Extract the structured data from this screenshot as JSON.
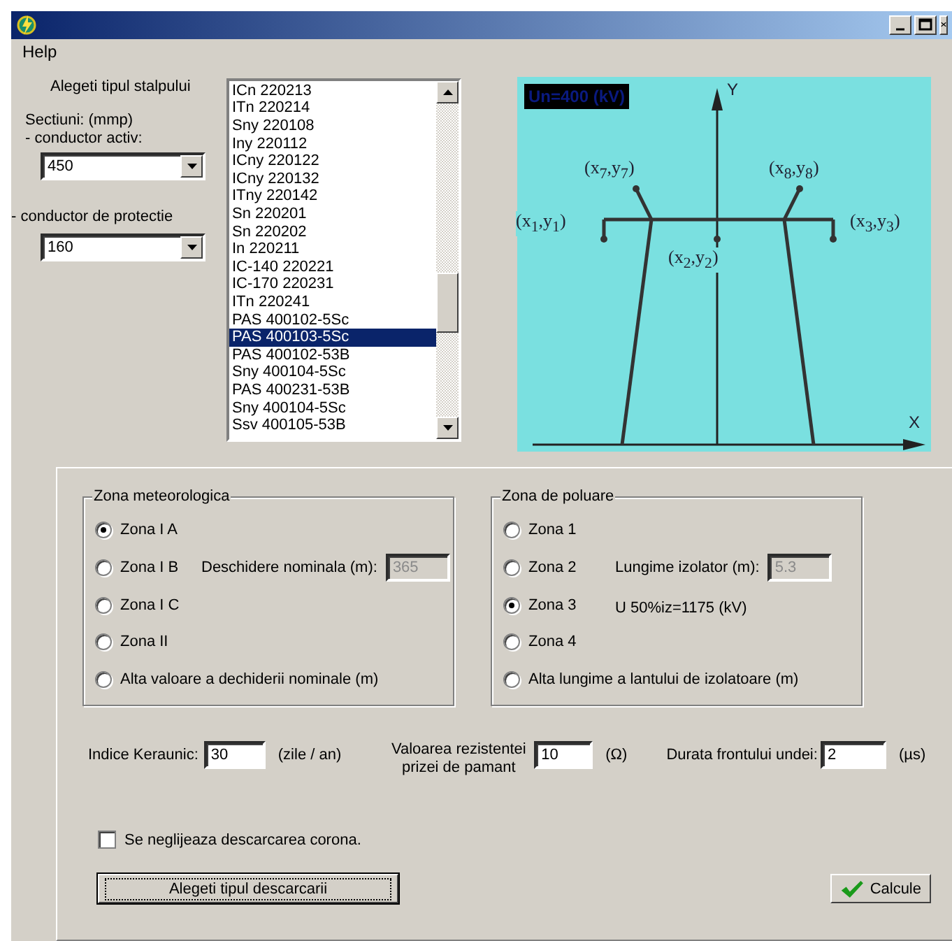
{
  "menu": [
    "Help"
  ],
  "pole_type": {
    "label": "Alegeti tipul stalpului",
    "items": [
      {
        "label": "ICn 220213",
        "selected": false
      },
      {
        "label": "ITn 220214",
        "selected": false
      },
      {
        "label": "Sny 220108",
        "selected": false
      },
      {
        "label": "Iny 220112",
        "selected": false
      },
      {
        "label": "ICny 220122",
        "selected": false
      },
      {
        "label": "ICny 220132",
        "selected": false
      },
      {
        "label": "ITny 220142",
        "selected": false
      },
      {
        "label": "Sn 220201",
        "selected": false
      },
      {
        "label": "Sn 220202",
        "selected": false
      },
      {
        "label": "In 220211",
        "selected": false
      },
      {
        "label": "IC-140 220221",
        "selected": false
      },
      {
        "label": "IC-170 220231",
        "selected": false
      },
      {
        "label": "ITn 220241",
        "selected": false
      },
      {
        "label": "PAS 400102-5Sc",
        "selected": false
      },
      {
        "label": "PAS 400103-5Sc",
        "selected": true
      },
      {
        "label": "PAS 400102-53B",
        "selected": false
      },
      {
        "label": "Sny 400104-5Sc",
        "selected": false
      },
      {
        "label": "PAS 400231-53B",
        "selected": false
      },
      {
        "label": "Sny 400104-5Sc",
        "selected": false
      },
      {
        "label": "Ssv 400105-53B",
        "selected": false
      }
    ]
  },
  "sections": {
    "label": "Sectiuni: (mmp)",
    "active_conductor": {
      "label": "- conductor activ:",
      "value": "450"
    },
    "protection_conductor": {
      "label": "- conductor de protectie",
      "value": "160"
    }
  },
  "diagram": {
    "voltage": "Un=400 (kV)",
    "y_axis": "Y",
    "x_axis": "X",
    "points": [
      "(x$_{7}$,y$_{7}$)",
      "(x$_{8}$,y$_{8}$)",
      "(x$_{1}$,y$_{1}$)",
      "(x$_{3}$,y$_{3}$)",
      "(x$_{2}$,y$_{2}$)"
    ]
  },
  "meteo_zone": {
    "title": "Zona meteorologica",
    "options": [
      {
        "label": "Zona I A",
        "selected": true
      },
      {
        "label": "Zona I B",
        "selected": false
      },
      {
        "label": "Zona I C",
        "selected": false
      },
      {
        "label": "Zona II",
        "selected": false
      },
      {
        "label": "Alta valoare a dechiderii nominale (m)",
        "selected": false
      }
    ],
    "field": {
      "label": "Deschidere nominala (m):",
      "value": "365",
      "disabled": true
    }
  },
  "pollution_zone": {
    "title": "Zona de poluare",
    "options": [
      {
        "label": "Zona 1",
        "selected": false
      },
      {
        "label": "Zona 2",
        "selected": false
      },
      {
        "label": "Zona 3",
        "selected": true
      },
      {
        "label": "Zona 4",
        "selected": false
      },
      {
        "label": "Alta lungime a lantului de izolatoare (m)",
        "selected": false
      }
    ],
    "field": {
      "label": "Lungime izolator (m):",
      "value": "5.3",
      "disabled": true
    },
    "note": "U 50%iz=1175 (kV)"
  },
  "params": [
    {
      "label": "Indice Keraunic:",
      "value": "30",
      "unit": "(zile / an)"
    },
    {
      "label": "Valoarea rezistentei prizei de pamant",
      "value": "10",
      "unit": "(Ω)"
    },
    {
      "label": "Durata frontului undei:",
      "value": "2",
      "unit": "(µs)"
    }
  ],
  "corona": {
    "label": "Se neglijeaza descarcarea corona.",
    "checked": false
  },
  "buttons": [
    {
      "kind": "plain",
      "label": "Alegeti tipul descarcarii",
      "focused": true
    },
    {
      "kind": "ok",
      "label": "Calcule",
      "focused": false
    }
  ]
}
